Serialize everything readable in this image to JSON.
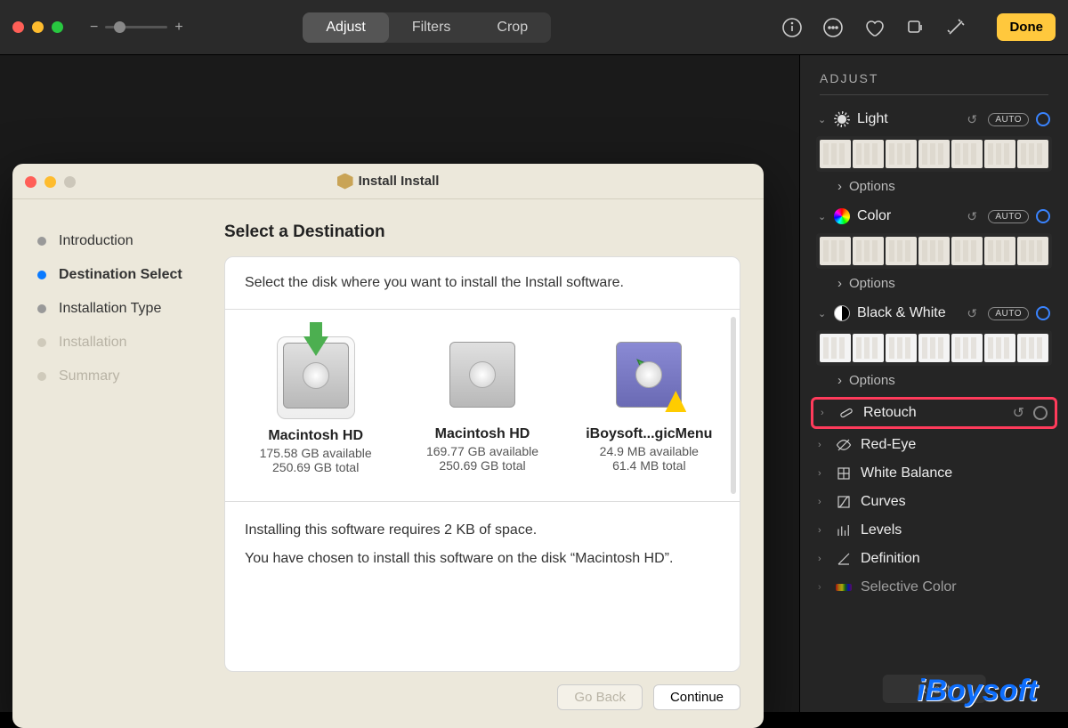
{
  "toolbar": {
    "segments": {
      "adjust": "Adjust",
      "filters": "Filters",
      "crop": "Crop"
    },
    "done": "Done"
  },
  "adjust_panel": {
    "title": "ADJUST",
    "auto": "AUTO",
    "options": "Options",
    "sections": {
      "light": "Light",
      "color": "Color",
      "bw": "Black & White",
      "retouch": "Retouch",
      "redeye": "Red-Eye",
      "white_balance": "White Balance",
      "curves": "Curves",
      "levels": "Levels",
      "definition": "Definition",
      "selective_color": "Selective Color"
    },
    "reset": "Reset"
  },
  "installer": {
    "title": "Install Install",
    "steps": {
      "introduction": "Introduction",
      "destination": "Destination Select",
      "install_type": "Installation Type",
      "installation": "Installation",
      "summary": "Summary"
    },
    "heading": "Select a Destination",
    "instruction": "Select the disk where you want to install the Install software.",
    "disks": [
      {
        "name": "Macintosh HD",
        "available": "175.58 GB available",
        "total": "250.69 GB total"
      },
      {
        "name": "Macintosh HD",
        "available": "169.77 GB available",
        "total": "250.69 GB total"
      },
      {
        "name": "iBoysoft...gicMenu",
        "available": "24.9 MB available",
        "total": "61.4 MB total"
      }
    ],
    "footer1": "Installing this software requires 2 KB of space.",
    "footer2": "You have chosen to install this software on the disk “Macintosh HD”.",
    "go_back": "Go Back",
    "continue": "Continue"
  },
  "watermark": "iBoysoft"
}
